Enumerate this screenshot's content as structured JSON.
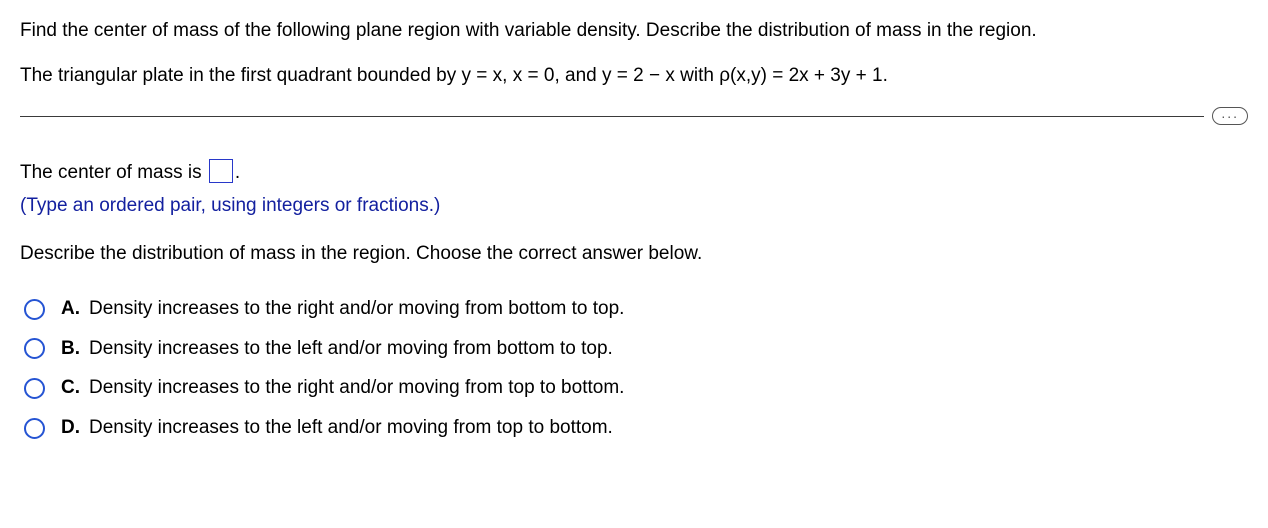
{
  "problem": {
    "line1": "Find the center of mass of the following plane region with variable density. Describe the distribution of mass in the region.",
    "line2": "The triangular plate in the first quadrant bounded by y = x, x = 0, and y = 2 − x with ρ(x,y) = 2x + 3y + 1."
  },
  "more_label": "...",
  "answer": {
    "prefix": "The center of mass is ",
    "suffix": ".",
    "hint": "(Type an ordered pair, using integers or fractions.)"
  },
  "prompt2": "Describe the distribution of mass in the region. Choose the correct answer below.",
  "options": [
    {
      "letter": "A.",
      "text": "Density increases to the right and/or moving from bottom to top."
    },
    {
      "letter": "B.",
      "text": "Density increases to the left and/or moving from bottom to top."
    },
    {
      "letter": "C.",
      "text": "Density increases to the right and/or moving from top to bottom."
    },
    {
      "letter": "D.",
      "text": "Density increases to the left and/or moving from top to bottom."
    }
  ]
}
